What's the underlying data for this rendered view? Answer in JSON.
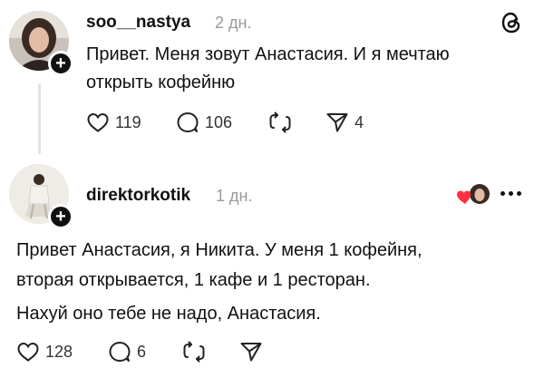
{
  "post1": {
    "username": "soo__nastya",
    "time": "2 дн.",
    "text_line1": "Привет. Меня зовут Анастасия. И я мечтаю",
    "text_line2": "открыть кофейню",
    "likes": "119",
    "comments": "106",
    "shares": "4"
  },
  "post2": {
    "username": "direktorkotik",
    "time": "1 дн.",
    "text_line1": "Привет Анастасия, я Никита. У меня 1 кофейня,",
    "text_line2": "вторая открывается, 1 кафе и 1 ресторан.",
    "text_line3": "Нахуй оно тебе не надо, Анастасия.",
    "likes": "128",
    "comments": "6"
  },
  "colors": {
    "text": "#111111",
    "muted": "#9a9a9a",
    "like_heart": "#ff3040",
    "thread_line": "#e3e3e3"
  },
  "icons": [
    "threads-logo-icon",
    "heart-icon",
    "comment-icon",
    "repost-icon",
    "send-icon",
    "more-icon",
    "plus-icon"
  ]
}
